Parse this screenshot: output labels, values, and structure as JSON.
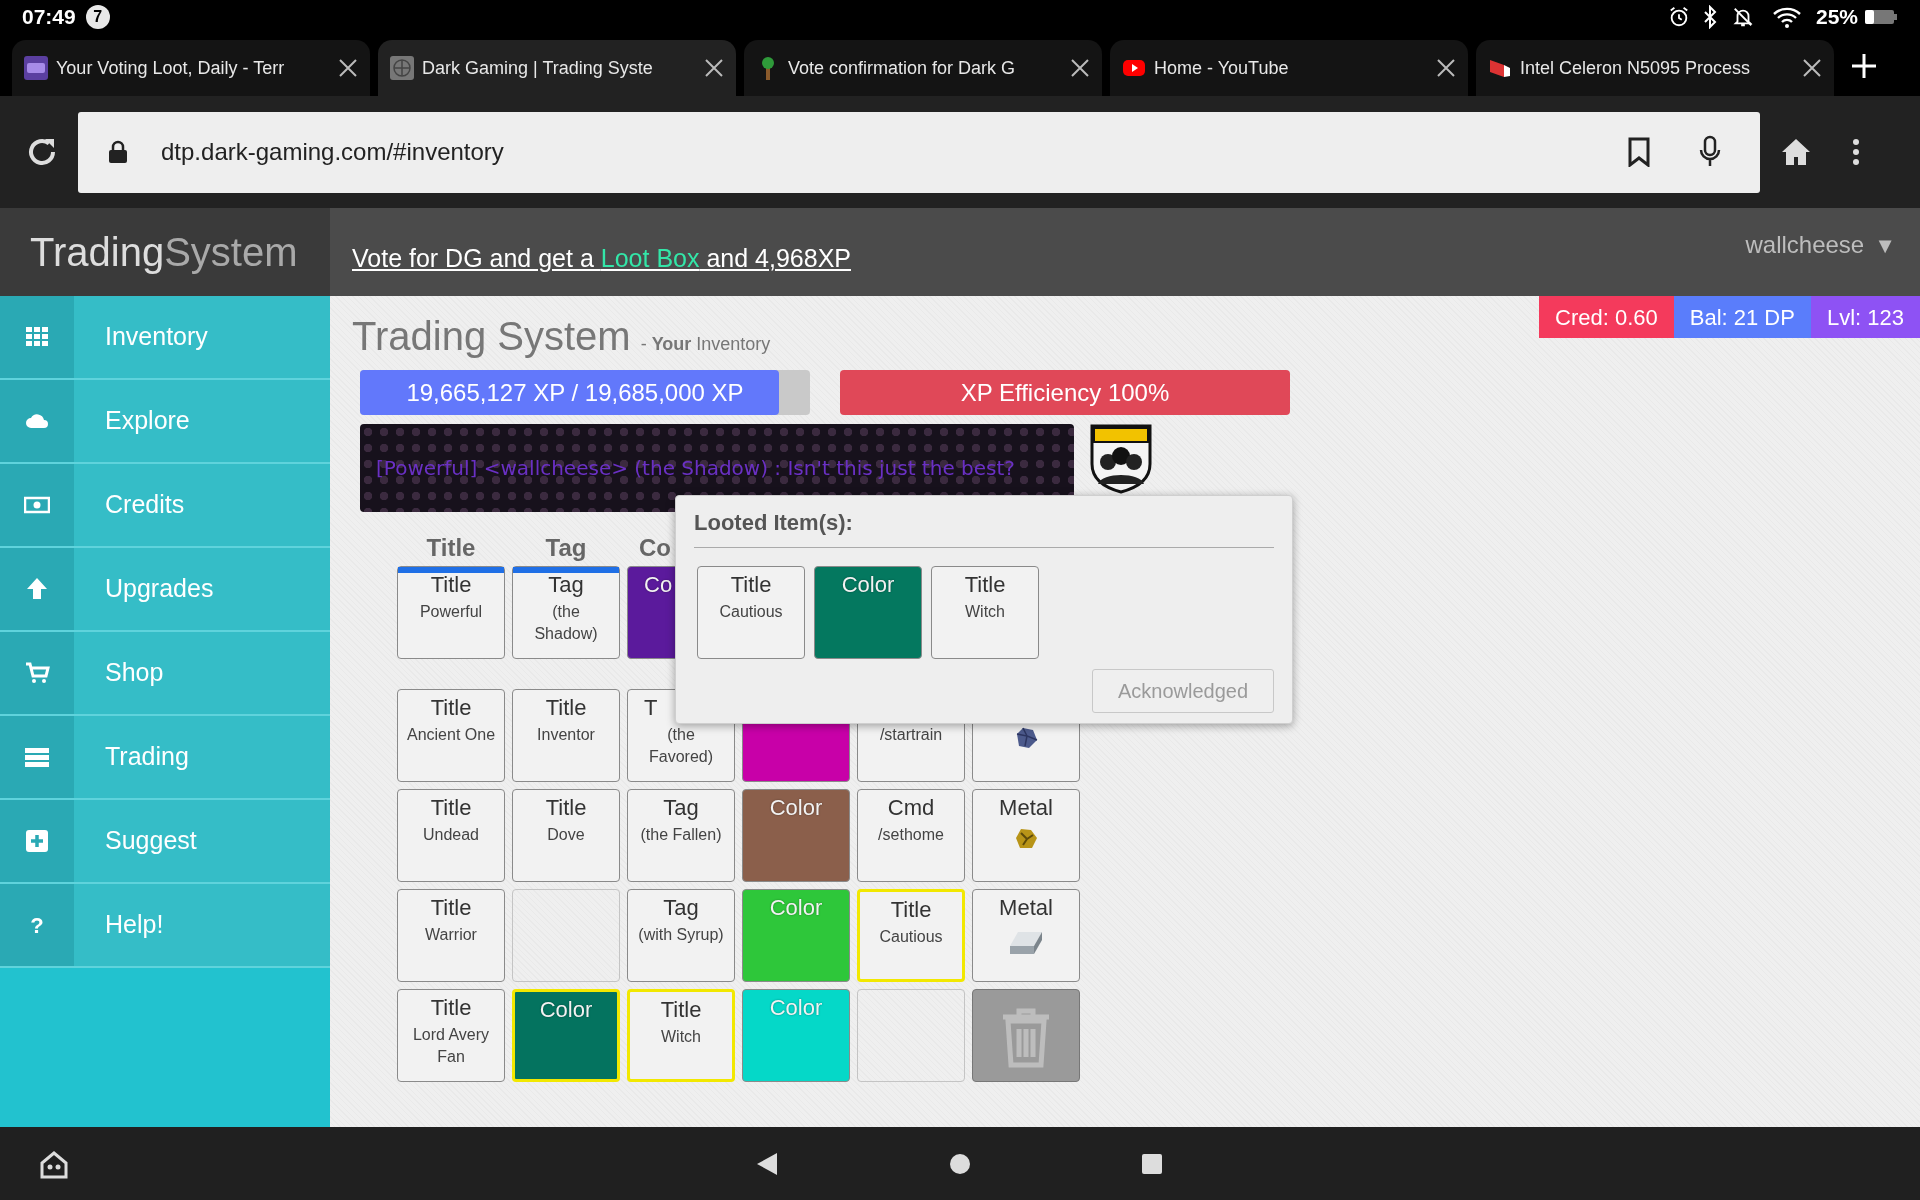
{
  "status_bar": {
    "time": "07:49",
    "notification_count": "7",
    "battery": "25%"
  },
  "browser": {
    "tabs": [
      {
        "title": "Your Voting Loot, Daily - Terr",
        "kind": "dg",
        "selected": false
      },
      {
        "title": "Dark Gaming | Trading Syste",
        "kind": "globe",
        "selected": true
      },
      {
        "title": "Vote confirmation for Dark G",
        "kind": "tree",
        "selected": false
      },
      {
        "title": "Home - YouTube",
        "kind": "youtube",
        "selected": false
      },
      {
        "title": "Intel Celeron N5095 Process",
        "kind": "laptop",
        "selected": false
      }
    ],
    "url": "dtp.dark-gaming.com/#inventory"
  },
  "site_header": {
    "brand_first": "Trading",
    "brand_second": "System",
    "vote_before": "Vote for DG and get a ",
    "vote_highlight": "Loot Box",
    "vote_after": " and 4,968XP",
    "user": "wallcheese",
    "user_caret": "▼"
  },
  "sidebar": {
    "items": [
      {
        "label": "Inventory",
        "kind": "grid"
      },
      {
        "label": "Explore",
        "kind": "cloud"
      },
      {
        "label": "Credits",
        "kind": "money"
      },
      {
        "label": "Upgrades",
        "kind": "arrow"
      },
      {
        "label": "Shop",
        "kind": "cart"
      },
      {
        "label": "Trading",
        "kind": "server"
      },
      {
        "label": "Suggest",
        "kind": "plus"
      },
      {
        "label": "Help!",
        "kind": "help",
        "glyph": "?"
      }
    ]
  },
  "stats": [
    {
      "text": "Cred: 0.60",
      "color": "#f43a5c"
    },
    {
      "text": "Bal: 21 DP",
      "color": "#5a7dfb"
    },
    {
      "text": "Lvl: 123",
      "color": "#8e52f4"
    }
  ],
  "page_title": "Trading System",
  "subtitle": "- **Your** Inventory",
  "xp_bar": {
    "text": "19,665,127 XP / 19,685,000 XP",
    "level": 0.93
  },
  "efficiency": {
    "text": "XP Efficiency 100%"
  },
  "chat_preview": {
    "text": "[Powerful] <wallcheese> (the Shadow) : Isn't this just the best?"
  },
  "inventory": {
    "columns": [
      {
        "label": "Title",
        "clipped": false
      },
      {
        "label": "Tag",
        "clipped": false
      },
      {
        "label": "Co",
        "clipped": true
      }
    ],
    "rows": [
      [
        {
          "kind": "item",
          "label": "Title",
          "sub": "Powerful",
          "equipped": true,
          "new": false
        },
        {
          "kind": "item",
          "label": "Tag",
          "sub": "(the Shadow)",
          "equipped": true,
          "new": false
        },
        {
          "kind": "swatch",
          "label": "Co",
          "color": "#5b1a9c",
          "clipped": true,
          "equipped": false,
          "new": false
        }
      ],
      [
        {
          "kind": "item",
          "label": "Title",
          "sub": "Ancient One",
          "equipped": false,
          "new": false
        },
        {
          "kind": "item",
          "label": "Title",
          "sub": "Inventor",
          "equipped": false,
          "new": false
        },
        {
          "kind": "item",
          "label": "T",
          "sub": "(the Favored)",
          "clipped": true,
          "equipped": false,
          "new": false
        },
        {
          "kind": "swatch",
          "color": "#c800a8",
          "new": false
        },
        {
          "kind": "item",
          "sub": "/startrain",
          "new": false
        },
        {
          "kind": "ore",
          "new": false
        }
      ],
      [
        {
          "kind": "item",
          "label": "Title",
          "sub": "Undead",
          "equipped": false,
          "new": false
        },
        {
          "kind": "item",
          "label": "Title",
          "sub": "Dove",
          "equipped": false,
          "new": false
        },
        {
          "kind": "item",
          "label": "Tag",
          "sub": "(the Fallen)",
          "equipped": false,
          "new": false
        },
        {
          "kind": "swatch",
          "label": "Color",
          "color": "#8b5f4b",
          "equipped": false,
          "new": false
        },
        {
          "kind": "item",
          "label": "Cmd",
          "sub": "/sethome",
          "equipped": false,
          "new": false
        },
        {
          "kind": "nugget",
          "label": "Metal",
          "equipped": false,
          "new": false
        }
      ],
      [
        {
          "kind": "item",
          "label": "Title",
          "sub": "Warrior",
          "equipped": false,
          "new": false
        },
        {
          "kind": "empty"
        },
        {
          "kind": "item",
          "label": "Tag",
          "sub": "(with Syrup)",
          "equipped": false,
          "new": false
        },
        {
          "kind": "swatch",
          "label": "Color",
          "color": "#2ec73a",
          "equipped": false,
          "new": false
        },
        {
          "kind": "item",
          "label": "Title",
          "sub": "Cautious",
          "equipped": false,
          "new": true
        },
        {
          "kind": "ingot",
          "label": "Metal",
          "equipped": false,
          "new": false
        }
      ],
      [
        {
          "kind": "item",
          "label": "Title",
          "sub": "Lord Avery Fan",
          "equipped": false,
          "new": false
        },
        {
          "kind": "swatch",
          "label": "Color",
          "color": "#04735f",
          "equipped": false,
          "new": true
        },
        {
          "kind": "item",
          "label": "Title",
          "sub": "Witch",
          "equipped": false,
          "new": true
        },
        {
          "kind": "swatch",
          "label": "Color",
          "color": "#05d8c8",
          "equipped": false,
          "new": false
        },
        {
          "kind": "empty"
        },
        {
          "kind": "trash"
        }
      ]
    ]
  },
  "loot_popup": {
    "title": "Looted Item(s):",
    "items": [
      {
        "kind": "item",
        "label": "Title",
        "sub": "Cautious"
      },
      {
        "kind": "swatch",
        "label": "Color",
        "color": "#04785f"
      },
      {
        "kind": "item",
        "label": "Title",
        "sub": "Witch"
      }
    ],
    "button": "Acknowledged",
    "button_disabled": true
  },
  "nav_bar": [
    {
      "kind": "assistant"
    },
    {
      "kind": "back"
    },
    {
      "kind": "home"
    },
    {
      "kind": "recents"
    }
  ]
}
